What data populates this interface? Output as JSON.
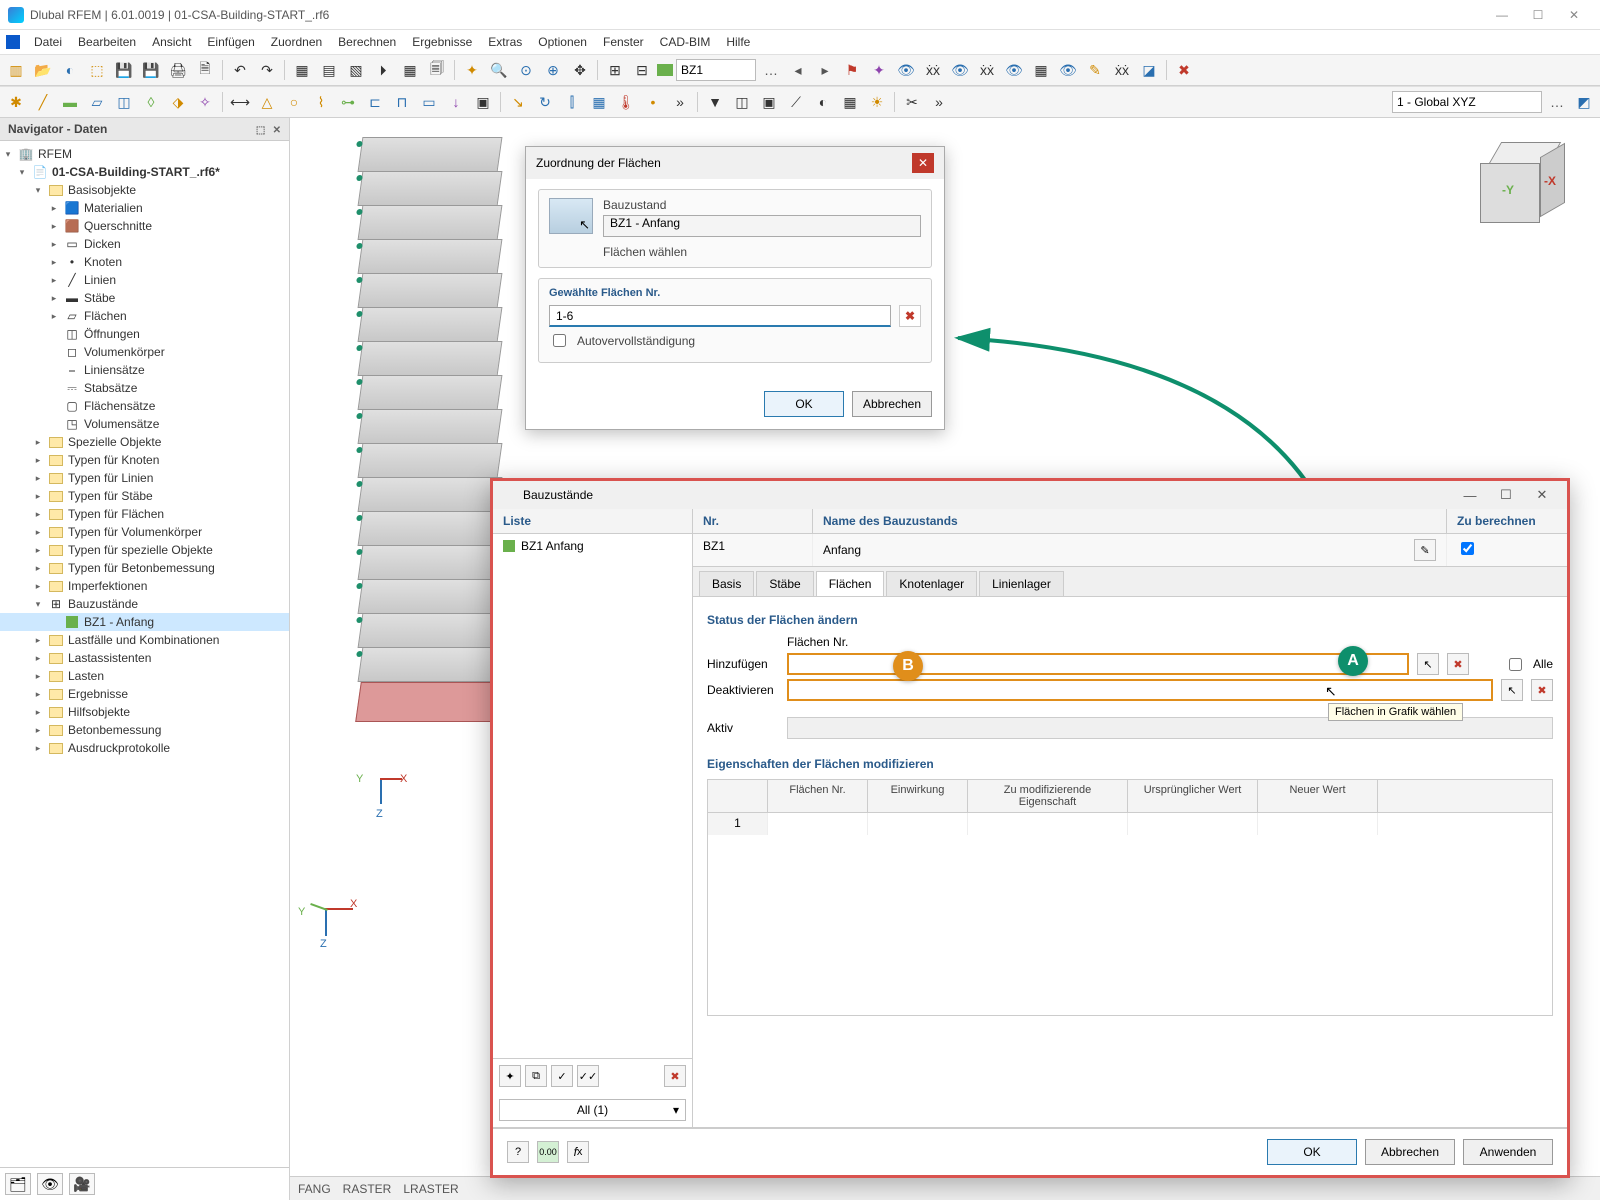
{
  "titlebar": {
    "text": "Dlubal RFEM | 6.01.0019 | 01-CSA-Building-START_.rf6"
  },
  "menu": [
    "Datei",
    "Bearbeiten",
    "Ansicht",
    "Einfügen",
    "Zuordnen",
    "Berechnen",
    "Ergebnisse",
    "Extras",
    "Optionen",
    "Fenster",
    "CAD-BIM",
    "Hilfe"
  ],
  "toolbar_select": "BZ1",
  "coord_select": "1 - Global XYZ",
  "navigator": {
    "title": "Navigator - Daten",
    "root": "RFEM",
    "file": "01-CSA-Building-START_.rf6*",
    "basisobjekte": "Basisobjekte",
    "items_basis": [
      "Materialien",
      "Querschnitte",
      "Dicken",
      "Knoten",
      "Linien",
      "Stäbe",
      "Flächen",
      "Öffnungen",
      "Volumenkörper",
      "Liniensätze",
      "Stabsätze",
      "Flächensätze",
      "Volumensätze"
    ],
    "items_mid": [
      "Spezielle Objekte",
      "Typen für Knoten",
      "Typen für Linien",
      "Typen für Stäbe",
      "Typen für Flächen",
      "Typen für Volumenkörper",
      "Typen für spezielle Objekte",
      "Typen für Betonbemessung",
      "Imperfektionen"
    ],
    "bauzustaende": "Bauzustände",
    "bz1": "BZ1 - Anfang",
    "items_end": [
      "Lastfälle und Kombinationen",
      "Lastassistenten",
      "Lasten",
      "Ergebnisse",
      "Hilfsobjekte",
      "Betonbemessung",
      "Ausdruckprotokolle"
    ]
  },
  "statusbar": [
    "FANG",
    "RASTER",
    "LRASTER"
  ],
  "dlg1": {
    "title": "Zuordnung der Flächen",
    "bauzustand_label": "Bauzustand",
    "bauzustand_value": "BZ1 - Anfang",
    "flaechen_waehlen": "Flächen wählen",
    "gewaehlte": "Gewählte Flächen Nr.",
    "value": "1-6",
    "auto": "Autovervollständigung",
    "ok": "OK",
    "cancel": "Abbrechen"
  },
  "dlg2": {
    "title": "Bauzustände",
    "liste": "Liste",
    "liste_item": "BZ1  Anfang",
    "nr_hdr": "Nr.",
    "nr_val": "BZ1",
    "name_hdr": "Name des Bauzustands",
    "name_val": "Anfang",
    "calc_hdr": "Zu berechnen",
    "tabs": [
      "Basis",
      "Stäbe",
      "Flächen",
      "Knotenlager",
      "Linienlager"
    ],
    "active_tab": 2,
    "sect1": "Status der Flächen ändern",
    "flaechen_nr": "Flächen Nr.",
    "hinzu": "Hinzufügen",
    "deakt": "Deaktivieren",
    "aktiv": "Aktiv",
    "alle": "Alle",
    "tooltip": "Flächen in Grafik wählen",
    "sect2": "Eigenschaften der Flächen modifizieren",
    "cols": [
      "",
      "Flächen Nr.",
      "Einwirkung",
      "Zu modifizierende Eigenschaft",
      "Ursprünglicher Wert",
      "Neuer Wert"
    ],
    "row1": "1",
    "all_sel": "All (1)",
    "ok": "OK",
    "cancel": "Abbrechen",
    "apply": "Anwenden"
  },
  "badges": {
    "a": "A",
    "b": "B"
  }
}
